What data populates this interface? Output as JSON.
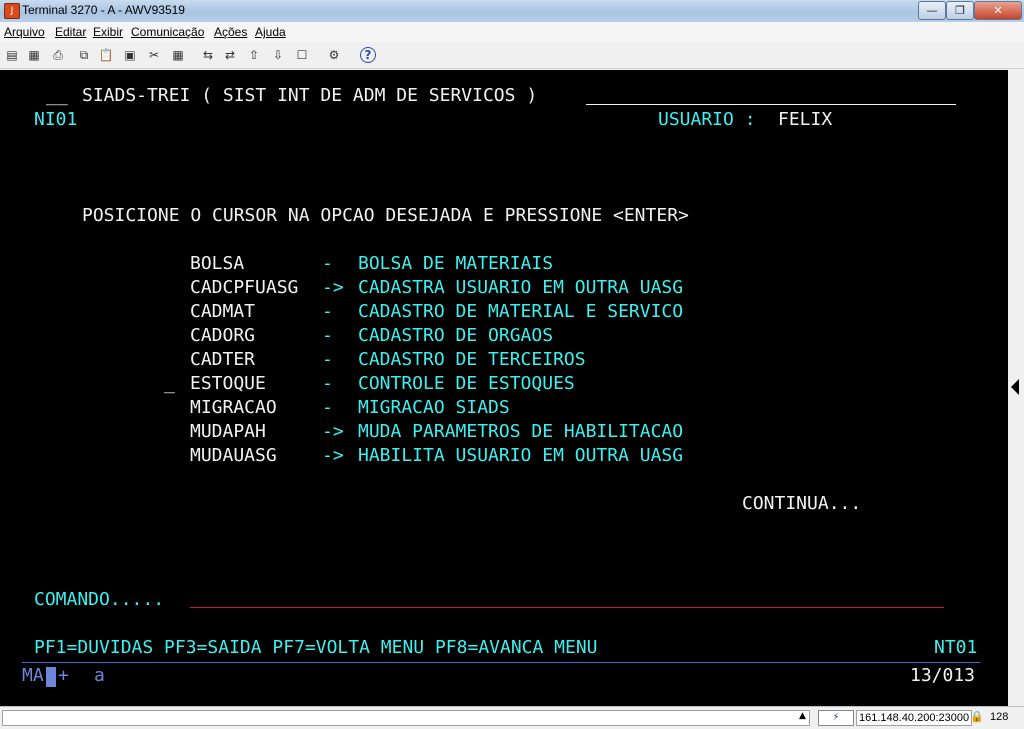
{
  "window": {
    "title": "Terminal 3270 - A - AWV93519",
    "icon_glyph": "J",
    "minimize_glyph": "—",
    "maximize_glyph": "❐",
    "close_glyph": "✕"
  },
  "menu": [
    "Arquivo",
    "Editar",
    "Exibir",
    "Comunicação",
    "Ações",
    "Ajuda"
  ],
  "toolbar": {
    "icons": [
      "print-icon",
      "print-setup-icon",
      "print-screen-icon",
      "copy-icon",
      "paste-icon",
      "paste-special-icon",
      "cut-icon",
      "select-all-icon",
      "connect-icon",
      "disconnect-icon",
      "send-file-icon",
      "receive-file-icon",
      "macro-icon",
      "settings-icon",
      "help-icon"
    ],
    "glyphs": [
      "▤",
      "▦",
      "⎙",
      "⧉",
      "📋",
      "▣",
      "✂",
      "▦",
      "⇆",
      "⇄",
      "⇧",
      "⇩",
      "☐",
      "⚙",
      "?"
    ]
  },
  "terminal": {
    "header_prefix": "__",
    "header_title": "SIADS-TREI ( SIST INT DE ADM DE SERVICOS )",
    "screen_id": "NI01",
    "user_label": "USUARIO :",
    "user_value": "FELIX",
    "instruction": "POSICIONE O CURSOR NA OPCAO DESEJADA E PRESSIONE <ENTER>",
    "cursor_mark": "_",
    "options": [
      {
        "code": "BOLSA",
        "sep": "-",
        "desc": "BOLSA DE MATERIAIS"
      },
      {
        "code": "CADCPFUASG",
        "sep": "->",
        "desc": "CADASTRA USUARIO EM OUTRA UASG"
      },
      {
        "code": "CADMAT",
        "sep": "-",
        "desc": "CADASTRO DE MATERIAL E SERVICO"
      },
      {
        "code": "CADORG",
        "sep": "-",
        "desc": "CADASTRO DE ORGAOS"
      },
      {
        "code": "CADTER",
        "sep": "-",
        "desc": "CADASTRO DE TERCEIROS"
      },
      {
        "code": "ESTOQUE",
        "sep": "-",
        "desc": "CONTROLE DE ESTOQUES"
      },
      {
        "code": "MIGRACAO",
        "sep": "-",
        "desc": "MIGRACAO SIADS"
      },
      {
        "code": "MUDAPAH",
        "sep": "->",
        "desc": "MUDA PARAMETROS DE HABILITACAO"
      },
      {
        "code": "MUDAUASG",
        "sep": "->",
        "desc": "HABILITA USUARIO EM OUTRA UASG"
      }
    ],
    "continue_text": "CONTINUA...",
    "command_label": "COMANDO.....",
    "pf_keys": "PF1=DUVIDAS PF3=SAIDA PF7=VOLTA MENU PF8=AVANCA MENU",
    "screen_code": "NT01"
  },
  "oia": {
    "indicator": "MA",
    "plus": "+",
    "insert_char": "a",
    "cursor_position": "13/013"
  },
  "status": {
    "connection_icon": "connection-icon",
    "connection_glyph": "⚡",
    "host": "161.148.40.200:23000",
    "lock_icon": "lock-icon",
    "lock_glyph": "🔒",
    "bits": "128",
    "scroll_glyph": "▲"
  },
  "colors": {
    "screen_bg": "#000000",
    "text_white": "#f2f2f2",
    "text_cyan": "#3cf0f0",
    "input_underline": "#c8222a",
    "oia_line": "#3b6fd0"
  }
}
